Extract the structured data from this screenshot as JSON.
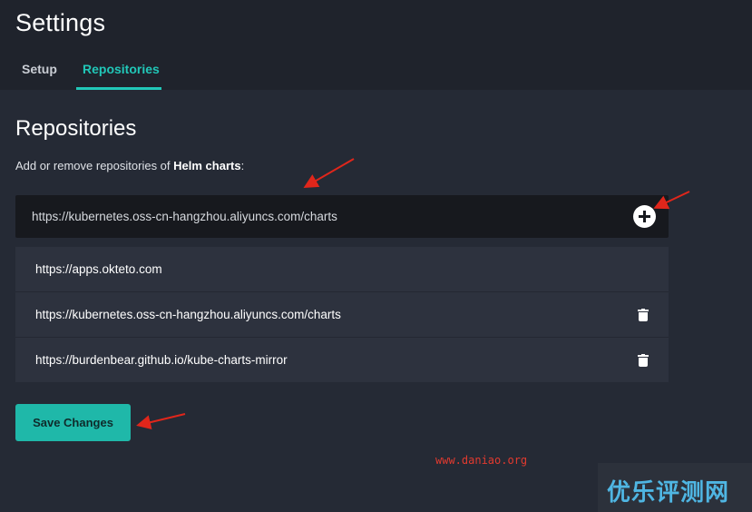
{
  "header": {
    "title": "Settings",
    "tabs": [
      {
        "label": "Setup",
        "active": false
      },
      {
        "label": "Repositories",
        "active": true
      }
    ]
  },
  "main": {
    "section_title": "Repositories",
    "description_prefix": "Add or remove repositories of ",
    "description_bold": "Helm charts",
    "description_suffix": ":",
    "new_repo_value": "https://kubernetes.oss-cn-hangzhou.aliyuncs.com/charts",
    "repos": [
      {
        "url": "https://apps.okteto.com",
        "deletable": false
      },
      {
        "url": "https://kubernetes.oss-cn-hangzhou.aliyuncs.com/charts",
        "deletable": true
      },
      {
        "url": "https://burdenbear.github.io/kube-charts-mirror",
        "deletable": true
      }
    ],
    "save_label": "Save Changes"
  },
  "watermark": {
    "url": "www.daniao.org",
    "badge": "优乐评测网"
  },
  "colors": {
    "accent": "#21c7b8",
    "button": "#1fb8a9",
    "annotation_arrow": "#e0261b"
  },
  "icons": [
    "plus-circle-icon",
    "trash-icon"
  ]
}
